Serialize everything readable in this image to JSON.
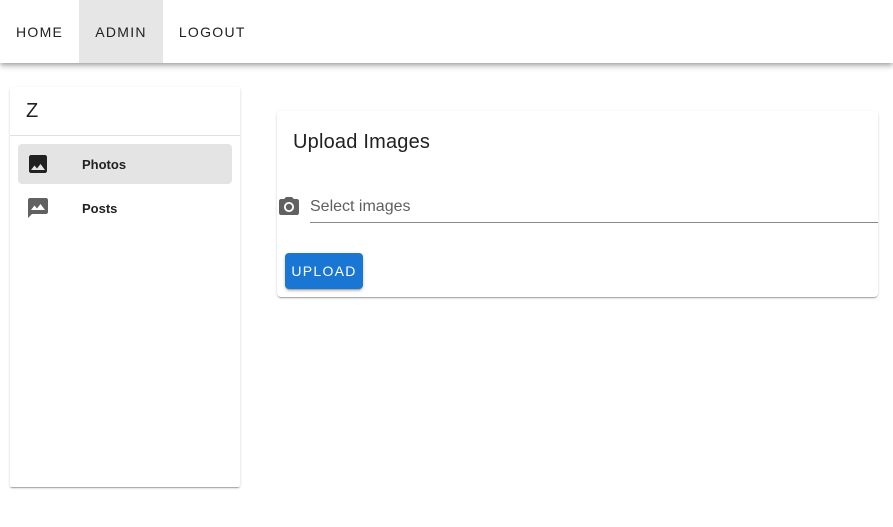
{
  "topbar": {
    "nav": [
      {
        "label": "HOME",
        "active": false
      },
      {
        "label": "ADMIN",
        "active": true
      },
      {
        "label": "LOGOUT",
        "active": false
      }
    ]
  },
  "sidebar": {
    "title": "Z",
    "items": [
      {
        "label": "Photos",
        "icon": "image-icon",
        "active": true
      },
      {
        "label": "Posts",
        "icon": "photo-album-icon",
        "active": false
      }
    ]
  },
  "upload": {
    "title": "Upload Images",
    "file_placeholder": "Select images",
    "button_label": "UPLOAD"
  },
  "colors": {
    "primary": "#1976d2",
    "active_bg": "#e4e4e4",
    "icon_color": "#616161"
  }
}
